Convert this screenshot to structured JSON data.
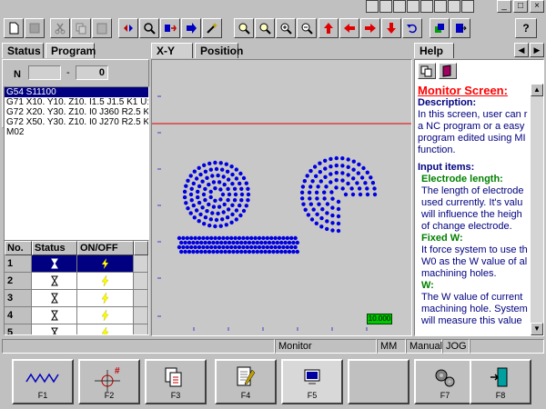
{
  "window": {
    "controls": [
      "_",
      "□",
      "×"
    ]
  },
  "toolbar": {
    "help_symbol": "?"
  },
  "left_panel": {
    "tabs": [
      "Status",
      "Program"
    ],
    "n_label": "N",
    "n_dash": "-",
    "n_value": "0",
    "program_lines": [
      "G54 S11100",
      "G71 X10. Y10. Z10. I1.5 J1.5 K1 U:",
      "G72 X20. Y30. Z10. I0 J360 R2.5 K",
      "G72 X50. Y30. Z10. I0 J270 R2.5 K",
      "M02"
    ],
    "table": {
      "headers": [
        "No.",
        "Status",
        "ON/OFF"
      ],
      "rows": [
        {
          "no": "1",
          "selected": true
        },
        {
          "no": "2",
          "selected": false
        },
        {
          "no": "3",
          "selected": false
        },
        {
          "no": "4",
          "selected": false
        },
        {
          "no": "5",
          "selected": false
        }
      ]
    }
  },
  "center_panel": {
    "tabs": [
      "X-Y",
      "Position"
    ],
    "scale_label": "10.000"
  },
  "help_panel": {
    "tab": "Help",
    "title": "Monitor Screen:",
    "description_label": "Description:",
    "description_lines": [
      "In this screen, user can r",
      "a NC program or a easy",
      "program edited using MI",
      "function."
    ],
    "input_label": "Input items:",
    "electrode_label": "Electrode length:",
    "electrode_lines": [
      "The length of electrode",
      "used currently.  It's valu",
      "will influence the heigh",
      "of change electrode."
    ],
    "fixed_label": "Fixed W:",
    "fixed_lines": [
      "It force system to use th",
      "W0 as the W value of al",
      "machining holes."
    ],
    "w_label": "W:",
    "w_lines": [
      "The W value of current",
      "machining hole. System",
      "will measure this value"
    ]
  },
  "status_bar": {
    "mode": "Monitor",
    "unit": "MM",
    "operation": "Manual",
    "jog": "JOG"
  },
  "function_keys": [
    {
      "label": "F1",
      "icon": "wave-icon"
    },
    {
      "label": "F2",
      "icon": "target-icon"
    },
    {
      "label": "F3",
      "icon": "documents-icon"
    },
    {
      "label": "F4",
      "icon": "edit-icon"
    },
    {
      "label": "F5",
      "icon": "monitor-icon"
    },
    {
      "label": "",
      "icon": ""
    },
    {
      "label": "F7",
      "icon": "gears-icon"
    },
    {
      "label": "F8",
      "icon": "exit-icon"
    }
  ]
}
